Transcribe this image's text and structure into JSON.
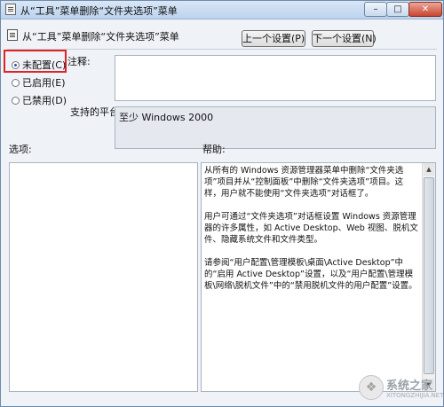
{
  "window": {
    "title": "从“工具”菜单删除“文件夹选项”菜单",
    "minimize_glyph": "–",
    "maximize_glyph": "□",
    "close_glyph": "✕"
  },
  "header": {
    "title": "从“工具”菜单删除“文件夹选项”菜单",
    "prev_label": "上一个设置(P)",
    "next_label": "下一个设置(N)"
  },
  "radios": [
    {
      "label": "未配置(C)",
      "checked": true
    },
    {
      "label": "已启用(E)",
      "checked": false
    },
    {
      "label": "已禁用(D)",
      "checked": false
    }
  ],
  "comment": {
    "label": "注释:",
    "value": ""
  },
  "platform": {
    "label": "支持的平台:",
    "value": "至少 Windows 2000"
  },
  "options": {
    "label": "选项:"
  },
  "help": {
    "label": "帮助:",
    "paragraphs": [
      "从所有的 Windows 资源管理器菜单中删除“文件夹选项”项目并从“控制面板”中删除“文件夹选项”项目。这样，用户就不能使用“文件夹选项”对话框了。",
      "用户可通过“文件夹选项”对话框设置 Windows 资源管理器的许多属性，如 Active Desktop、Web 视图、脱机文件、隐藏系统文件和文件类型。",
      "请参阅“用户配置\\管理模板\\桌面\\Active Desktop”中的“启用 Active Desktop”设置，以及“用户配置\\管理模板\\网络\\脱机文件”中的“禁用脱机文件的用户配置”设置。"
    ]
  },
  "watermark": {
    "text": "系统之家",
    "url": "XITONGZHIJIA.NET"
  },
  "colors": {
    "highlight": "#e02323",
    "accent": "#1d5ea8"
  }
}
